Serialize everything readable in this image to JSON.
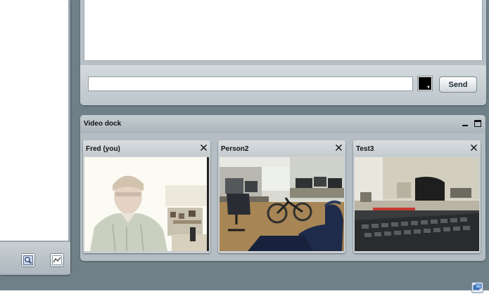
{
  "chat": {
    "message_value": "",
    "send_label": "Send",
    "text_color": "#000000"
  },
  "video_dock": {
    "title": "Video dock",
    "tiles": [
      {
        "name": "Fred (you)"
      },
      {
        "name": "Person2"
      },
      {
        "name": "Test3"
      }
    ]
  },
  "left_toolbar": {
    "icons": [
      "zoom-icon",
      "graph-icon"
    ]
  },
  "colors": {
    "background": "#6f8089",
    "panel": "#b7c1c7"
  }
}
